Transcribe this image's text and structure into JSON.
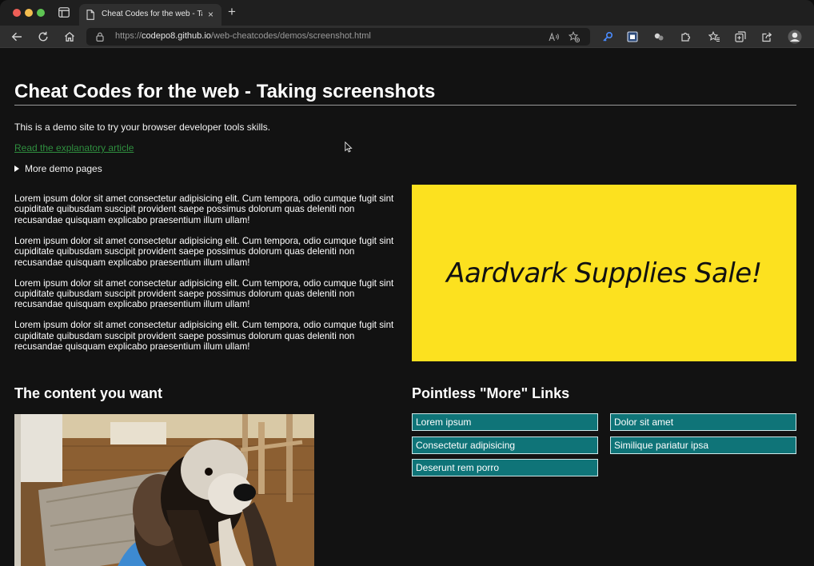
{
  "browser": {
    "tab_title": "Cheat Codes for the web - Taking screenshots",
    "tab_close": "×",
    "new_tab": "+",
    "url_prefix": "https://",
    "url_host": "codepo8.github.io",
    "url_path": "/web-cheatcodes/demos/screenshot.html"
  },
  "page": {
    "title": "Cheat Codes for the web - Taking screenshots",
    "intro": "This is a demo site to try your browser developer tools skills.",
    "article_link": "Read the explanatory article",
    "more_demo_pages": "More demo pages",
    "paragraphs": [
      "Lorem ipsum dolor sit amet consectetur adipisicing elit. Cum tempora, odio cumque fugit sint cupiditate quibusdam suscipit provident saepe possimus dolorum quas deleniti non recusandae quisquam explicabo praesentium illum ullam!",
      "Lorem ipsum dolor sit amet consectetur adipisicing elit. Cum tempora, odio cumque fugit sint cupiditate quibusdam suscipit provident saepe possimus dolorum quas deleniti non recusandae quisquam explicabo praesentium illum ullam!",
      "Lorem ipsum dolor sit amet consectetur adipisicing elit. Cum tempora, odio cumque fugit sint cupiditate quibusdam suscipit provident saepe possimus dolorum quas deleniti non recusandae quisquam explicabo praesentium illum ullam!",
      "Lorem ipsum dolor sit amet consectetur adipisicing elit. Cum tempora, odio cumque fugit sint cupiditate quibusdam suscipit provident saepe possimus dolorum quas deleniti non recusandae quisquam explicabo praesentium illum ullam!"
    ],
    "ad_text": "Aardvark Supplies Sale!",
    "content_heading": "The content you want",
    "links_heading": "Pointless \"More\" Links",
    "more_links": [
      "Lorem ipsum",
      "Dolor sit amet",
      "Consectetur adipisicing",
      "Similique pariatur ipsa",
      "Deserunt rem porro"
    ]
  },
  "colors": {
    "ad_background": "#fce11f",
    "link_button": "#0f7478",
    "article_link": "#2f8f3f"
  }
}
